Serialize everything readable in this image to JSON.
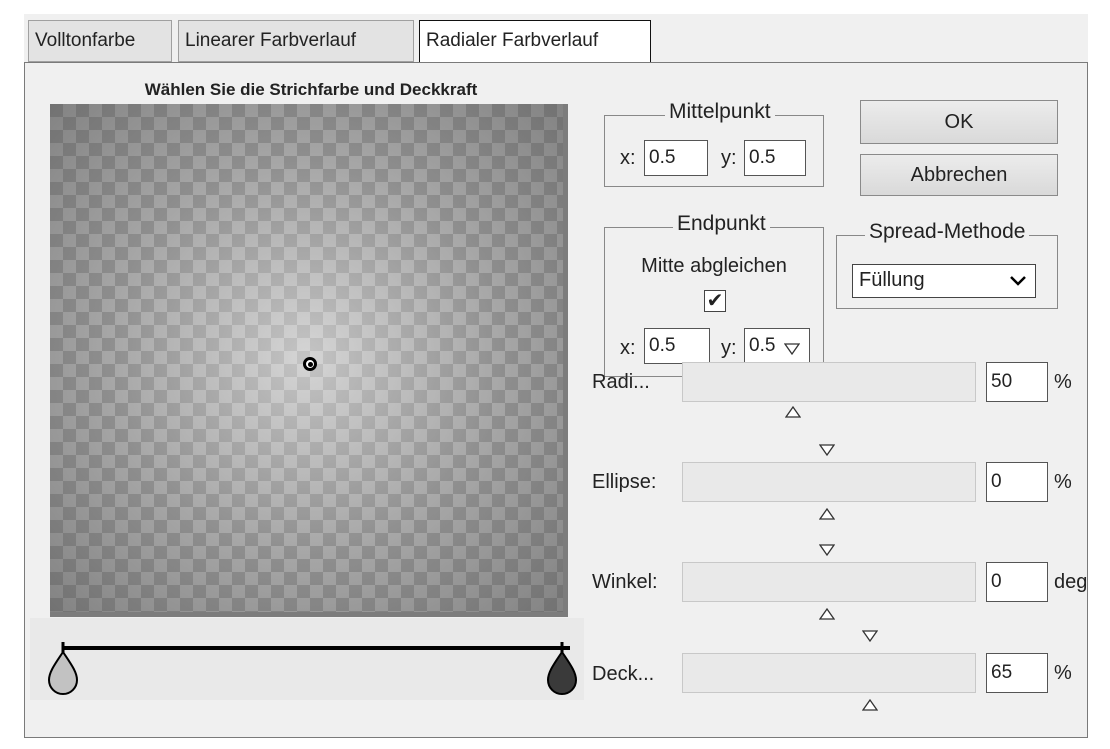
{
  "tabs": [
    "Volltonfarbe",
    "Linearer Farbverlauf",
    "Radialer Farbverlauf"
  ],
  "preview_title": "Wählen Sie die Strichfarbe und Deckkraft",
  "mittelpunkt": {
    "legend": "Mittelpunkt",
    "x_label": "x:",
    "x_value": "0.5",
    "y_label": "y:",
    "y_value": "0.5"
  },
  "endpunkt": {
    "legend": "Endpunkt",
    "match_label": "Mitte abgleichen",
    "match_checked": "✔",
    "x_label": "x:",
    "x_value": "0.5",
    "y_label": "y:",
    "y_value": "0.5"
  },
  "buttons": {
    "ok": "OK",
    "cancel": "Abbrechen"
  },
  "spread": {
    "legend": "Spread-Methode",
    "selected": "Füllung"
  },
  "sliders": {
    "radius": {
      "label": "Radi...",
      "value": "50",
      "unit": "%"
    },
    "ellipse": {
      "label": "Ellipse:",
      "value": "0",
      "unit": "%"
    },
    "winkel": {
      "label": "Winkel:",
      "value": "0",
      "unit": "deg"
    },
    "deckkraft": {
      "label": "Deck...",
      "value": "65",
      "unit": "%"
    }
  },
  "colors": {
    "stop_left": "#c2c2c2",
    "stop_right": "#3a3a3a"
  }
}
